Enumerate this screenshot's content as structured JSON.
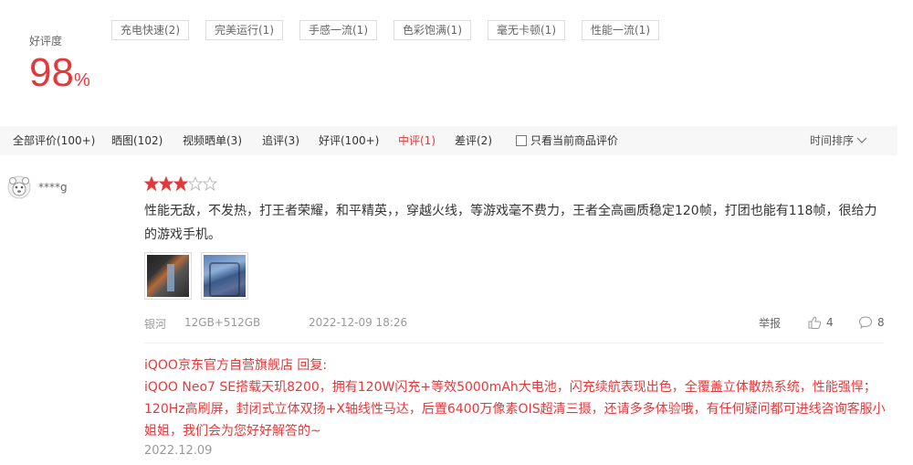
{
  "rating": {
    "label": "好评度",
    "value": "98",
    "unit": "%"
  },
  "tags": [
    "充电快速(2)",
    "完美运行(1)",
    "手感一流(1)",
    "色彩饱满(1)",
    "毫无卡顿(1)",
    "性能一流(1)"
  ],
  "filters": {
    "all": "全部评价(100+)",
    "photos": "晒图(102)",
    "video": "视频晒单(3)",
    "followup": "追评(3)",
    "good": "好评(100+)",
    "medium": "中评(1)",
    "bad": "差评(2)",
    "current_only": "只看当前商品评价",
    "sort": "时间排序"
  },
  "review": {
    "username": "****g",
    "stars": 3,
    "max_stars": 5,
    "text": "性能无敌，不发热，打王者荣耀，和平精英，，穿越火线，等游戏毫不费力，王者全高画质稳定120帧，打团也能有118帧，很给力的游戏手机。",
    "color": "银河",
    "spec": "12GB+512GB",
    "datetime": "2022-12-09 18:26",
    "report": "举报",
    "likes": "4",
    "comments": "8"
  },
  "reply": {
    "header": "iQOO京东官方自营旗舰店 回复:",
    "text": "iQOO Neo7 SE搭载天玑8200，拥有120W闪充+等效5000mAh大电池，闪充续航表现出色，全覆盖立体散热系统，性能强悍；120Hz高刷屏，封闭式立体双扬+X轴线性马达，后置6400万像素OIS超清三摄，还请多多体验哦，有任何疑问都可进线咨询客服小姐姐，我们会为您好好解答的~",
    "date": "2022.12.09"
  },
  "colors": {
    "accent": "#e4393c",
    "star": "#e4393c",
    "muted": "#999999"
  },
  "icons": [
    "avatar-icon",
    "star-icon",
    "checkbox-icon",
    "chevron-down-icon",
    "thumb-up-icon",
    "comment-icon"
  ]
}
